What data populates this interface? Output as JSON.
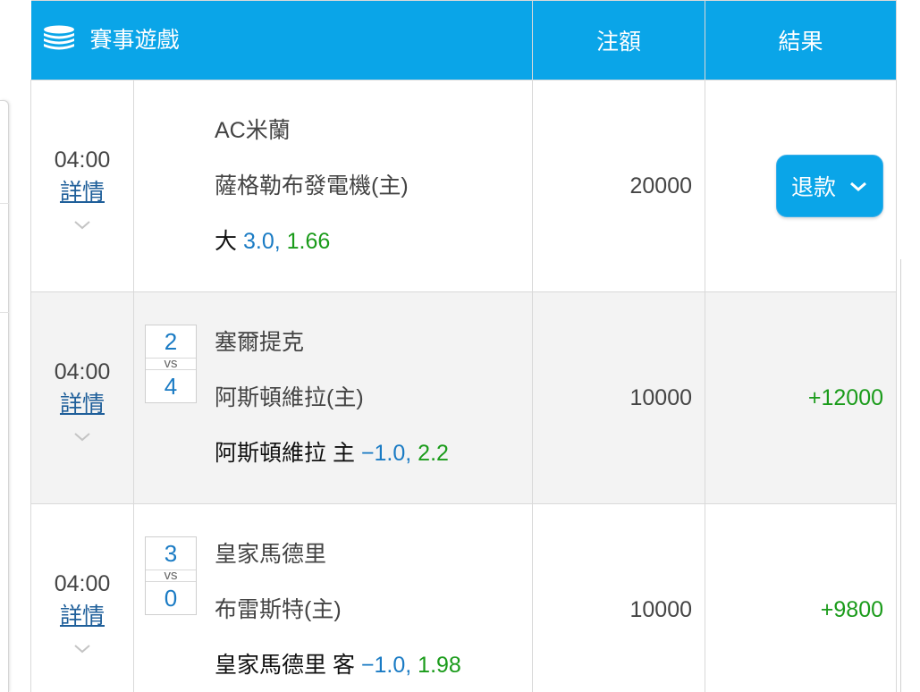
{
  "header": {
    "game_label": "賽事遊戲",
    "stake_label": "注額",
    "result_label": "結果"
  },
  "rows": [
    {
      "time": "04:00",
      "detail_label": "詳情",
      "score_home": "",
      "score_vs": "",
      "score_away": "",
      "team_away": "AC米蘭",
      "team_home": "薩格勒布發電機(主)",
      "bet_prefix": "大",
      "bet_line": "3.0,",
      "bet_odds": "1.66",
      "stake": "20000",
      "result": "",
      "refund_label": "退款"
    },
    {
      "time": "04:00",
      "detail_label": "詳情",
      "score_home": "2",
      "score_vs": "vs",
      "score_away": "4",
      "team_away": "塞爾提克",
      "team_home": "阿斯頓維拉(主)",
      "bet_prefix": "阿斯頓維拉 主",
      "bet_line": "−1.0,",
      "bet_odds": "2.2",
      "stake": "10000",
      "result": "+12000"
    },
    {
      "time": "04:00",
      "detail_label": "詳情",
      "score_home": "3",
      "score_vs": "vs",
      "score_away": "0",
      "team_away": "皇家馬德里",
      "team_home": "布雷斯特(主)",
      "bet_prefix": "皇家馬德里 客",
      "bet_line": "−1.0,",
      "bet_odds": "1.98",
      "stake": "10000",
      "result": "+9800"
    }
  ],
  "icons": {
    "header": "coin-stack-icon",
    "expand": "chevron-down-icon",
    "dropdown": "chevron-down-icon"
  },
  "colors": {
    "header_bg": "#0aa5e8",
    "link": "#1f5f9a",
    "line": "#1a7bc4",
    "odds": "#1a9b1a",
    "row_alt": "#f3f3f3"
  }
}
